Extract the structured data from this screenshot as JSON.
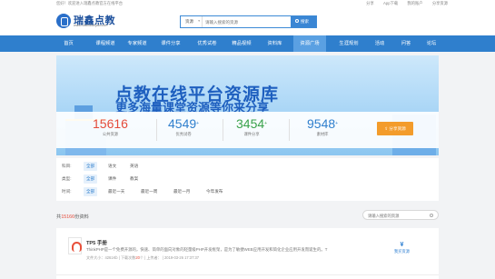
{
  "topbar": {
    "welcome": "您好！欢迎进入瑞鑫点教官方在线平台",
    "links": [
      "分享",
      "App下载",
      "我的账户",
      "分享资源"
    ]
  },
  "header": {
    "logo_text": "瑞鑫点教",
    "logo_sub": "www.ruixindianjiao.com",
    "search_category": "资源",
    "search_placeholder": "请输入搜索的资源",
    "search_button": "搜索"
  },
  "nav": {
    "items": [
      "首页",
      "课程频道",
      "专家频道",
      "课件分享",
      "优秀试卷",
      "精品视频",
      "资料库",
      "资源广场",
      "生涯规划",
      "活动",
      "问答",
      "论坛"
    ],
    "active_index": 7
  },
  "banner": {
    "title": "点教在线平台资源库",
    "subtitle": "更多海量课堂资源等你来分享",
    "stats": [
      {
        "value": "15616",
        "label": "公共资源",
        "color": "#e44b3a",
        "sup": ""
      },
      {
        "value": "4549",
        "label": "优秀试卷",
        "color": "#2f7fcd",
        "sup": "+"
      },
      {
        "value": "3454",
        "label": "课件分享",
        "color": "#3aa24b",
        "sup": "+"
      },
      {
        "value": "9548",
        "label": "素材库",
        "color": "#2f7fcd",
        "sup": "+"
      }
    ],
    "share_button": "分享资源"
  },
  "filters": [
    {
      "key": "科目:",
      "options": [
        "全部",
        "语文",
        "英语"
      ],
      "active": 0
    },
    {
      "key": "类型:",
      "options": [
        "全部",
        "课件",
        "教案"
      ],
      "active": 0
    },
    {
      "key": "时间:",
      "options": [
        "全部",
        "最近一天",
        "最近一周",
        "最近一月",
        "今年发布"
      ],
      "active": 0
    }
  ],
  "list": {
    "count_prefix": "共",
    "count": "15166",
    "count_suffix": "份资料",
    "search_placeholder": "请输入搜索的资源"
  },
  "items": [
    {
      "name": "TP5 手册",
      "desc": "ThinkPHP是一个免费开源的，快速、简单的面向对象的轻量级PHP开发框架，是为了敏捷WEB应用开发和简化企业应用开发而诞生的。T",
      "meta_size": "文件大小：4261Kb",
      "meta_downloads_prefix": "下载次数",
      "meta_downloads": "20",
      "meta_downloads_suffix": "个",
      "meta_uploader": "上传者：",
      "meta_time": "2019-03-26 17:37:37",
      "download_label": "我买资源"
    }
  ]
}
